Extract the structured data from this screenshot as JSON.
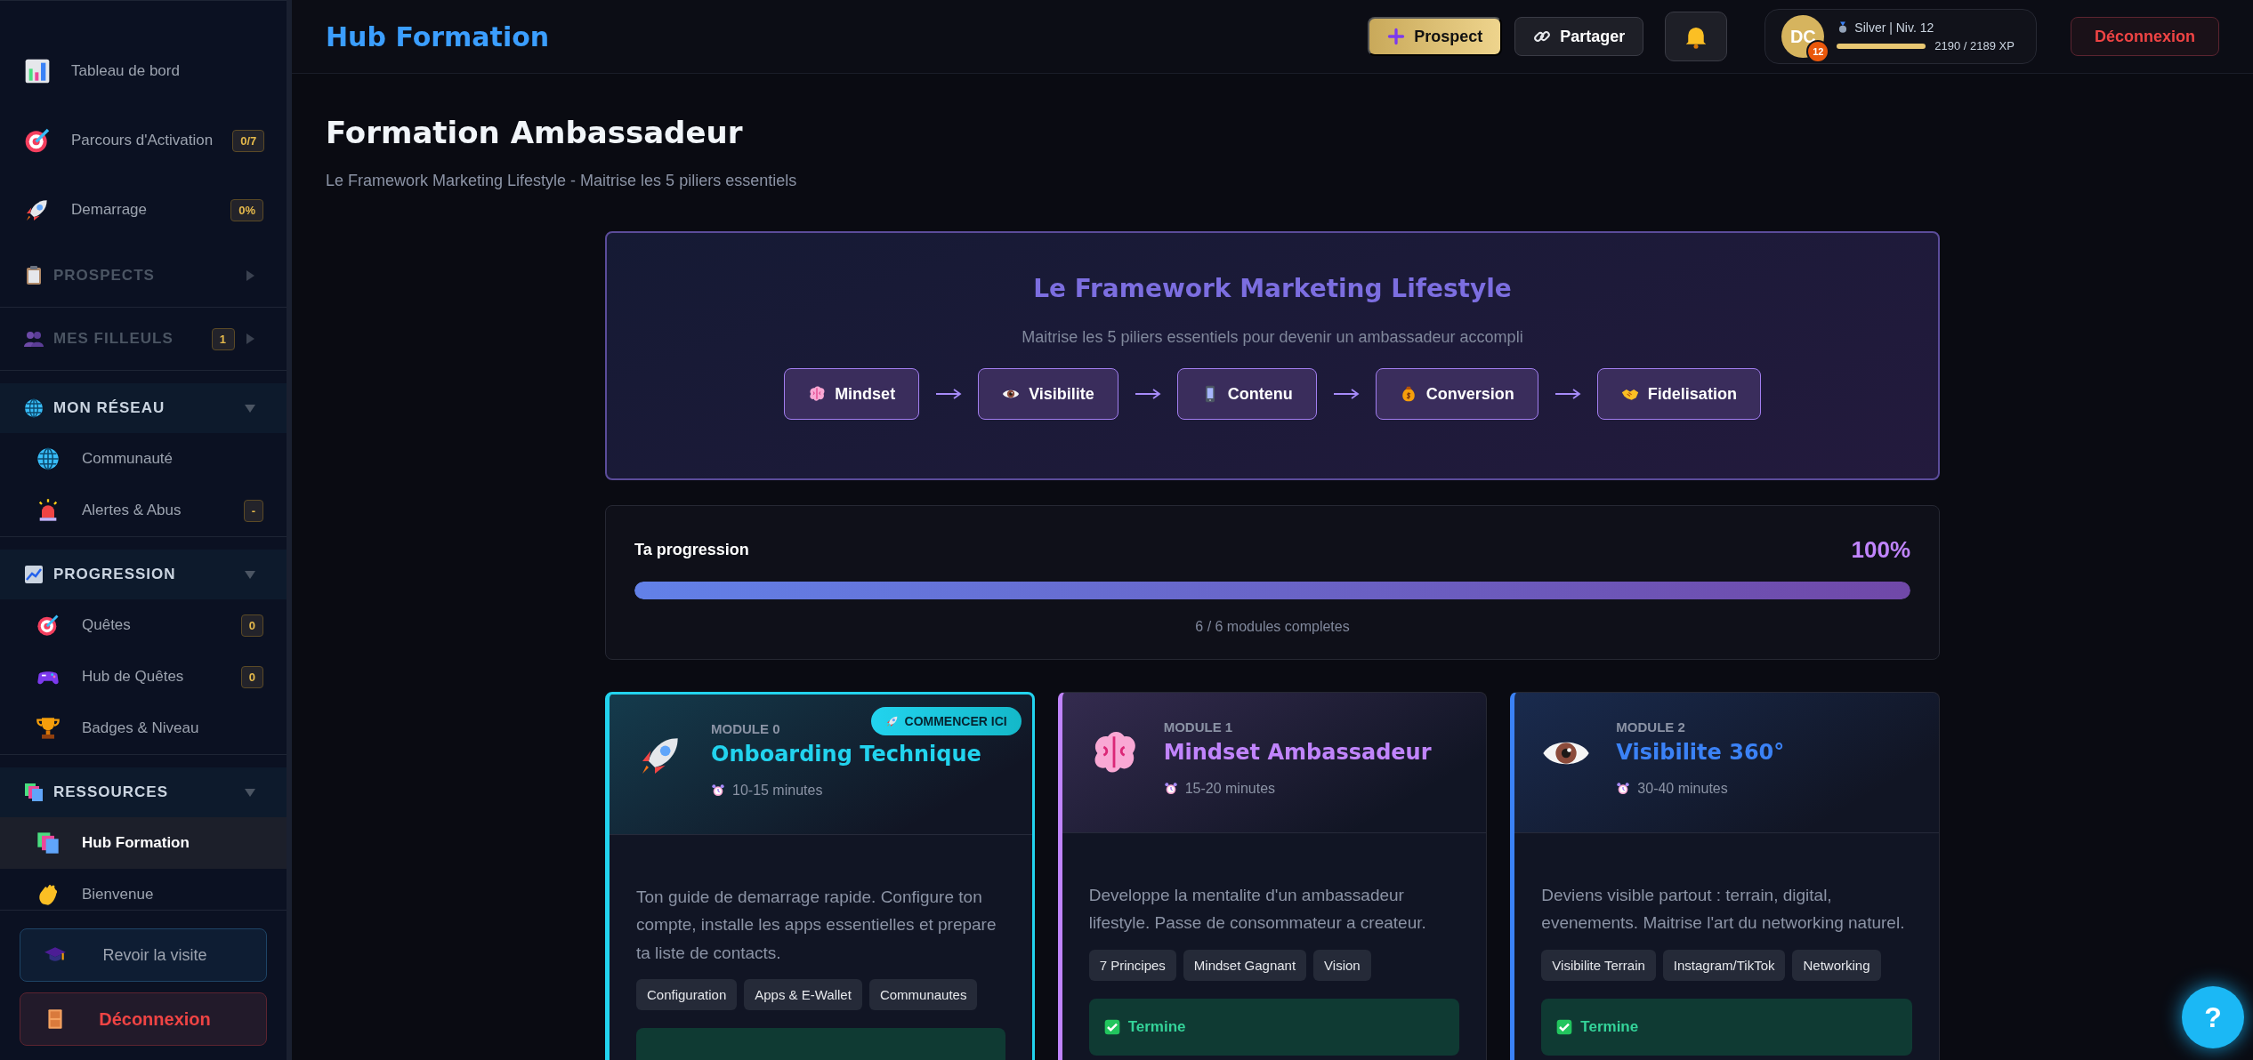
{
  "sidebar": {
    "links": [
      {
        "label": "Tableau de bord",
        "selected": false
      },
      {
        "label": "Parcours d'Activation",
        "badge": "0/7",
        "selected": false
      },
      {
        "label": "Demarrage",
        "badge": "0%",
        "selected": false
      }
    ],
    "sections": [
      {
        "label": "PROSPECTS",
        "expanded": false
      },
      {
        "label": "MES FILLEULS",
        "badge": "1",
        "expanded": false
      },
      {
        "label": "MON RÉSEAU",
        "expanded": true,
        "children": [
          {
            "label": "Communauté",
            "selected": false
          },
          {
            "label": "Alertes & Abus",
            "badge": "-",
            "selected": false
          }
        ]
      },
      {
        "label": "PROGRESSION",
        "expanded": true,
        "children": [
          {
            "label": "Quêtes",
            "badge": "0",
            "selected": false
          },
          {
            "label": "Hub de Quêtes",
            "badge": "0",
            "selected": false
          },
          {
            "label": "Badges & Niveau",
            "selected": false
          }
        ]
      },
      {
        "label": "RESSOURCES",
        "expanded": true,
        "children": [
          {
            "label": "Hub Formation",
            "selected": true
          },
          {
            "label": "Bienvenue",
            "selected": false
          }
        ]
      }
    ],
    "footer_buttons": [
      {
        "label": "Revoir la visite",
        "kind": "tour"
      },
      {
        "label": "Déconnexion",
        "kind": "logout"
      }
    ]
  },
  "header": {
    "title": "Hub Formation",
    "buttons": [
      {
        "label": "Prospect",
        "kind": "primary"
      },
      {
        "label": "Partager",
        "kind": "secondary"
      }
    ],
    "user": {
      "initials": "DC",
      "level_badge": "12",
      "rank": "Silver | Niv. 12",
      "xp": "2190 / 2189 XP",
      "level": 1
    },
    "logout": "Déconnexion"
  },
  "page": {
    "title": "Formation Ambassadeur",
    "subtitle": "Le Framework Marketing Lifestyle - Maitrise les 5 piliers essentiels"
  },
  "framework": {
    "title": "Le Framework Marketing Lifestyle",
    "subtitle": "Maitrise les 5 piliers essentiels pour devenir un ambassadeur accompli",
    "pillars": [
      "Mindset",
      "Visibilite",
      "Contenu",
      "Conversion",
      "Fidelisation"
    ]
  },
  "progress": {
    "label": "Ta progression",
    "percent": "100%",
    "level": 1,
    "caption": "6 / 6 modules completes"
  },
  "modules": [
    {
      "module": "MODULE 0",
      "title": "Onboarding Technique",
      "duration": "10-15 minutes",
      "color": "#22d3ee",
      "highlighted": true,
      "badge": "COMMENCER ICI",
      "description": "Ton guide de demarrage rapide. Configure ton compte, installe les apps essentielles et prepare ta liste de contacts.",
      "tags": [
        "Configuration",
        "Apps & E-Wallet",
        "Communautes"
      ],
      "completed": true
    },
    {
      "module": "MODULE 1",
      "title": "Mindset Ambassadeur",
      "duration": "15-20 minutes",
      "color": "#c084fc",
      "highlighted": false,
      "description": "Developpe la mentalite d'un ambassadeur lifestyle. Passe de consommateur a createur.",
      "tags": [
        "7 Principes",
        "Mindset Gagnant",
        "Vision"
      ],
      "completed": true,
      "status_label": "Termine"
    },
    {
      "module": "MODULE 2",
      "title": "Visibilite 360°",
      "duration": "30-40 minutes",
      "color": "#3b82f6",
      "highlighted": false,
      "description": "Deviens visible partout : terrain, digital, evenements. Maitrise l'art du networking naturel.",
      "tags": [
        "Visibilite Terrain",
        "Instagram/TikTok",
        "Networking"
      ],
      "completed": true,
      "status_label": "Termine"
    }
  ],
  "help_button": "?"
}
